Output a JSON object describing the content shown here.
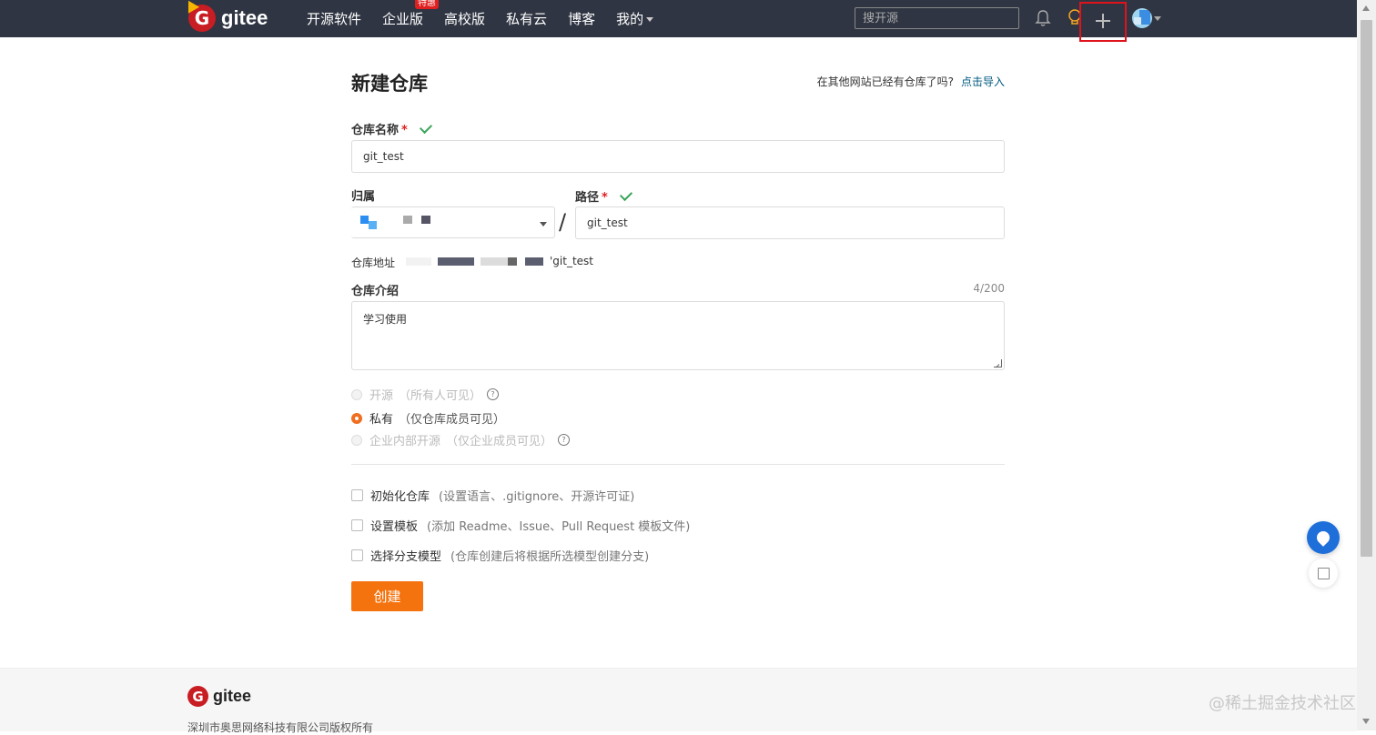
{
  "nav": {
    "brand": "gitee",
    "items": [
      "开源软件",
      "企业版",
      "高校版",
      "私有云",
      "博客",
      "我的"
    ],
    "badge": "特惠",
    "search_placeholder": "搜开源",
    "icons": [
      "bell-icon",
      "bulb-icon",
      "plus-icon",
      "avatar"
    ]
  },
  "form": {
    "title": "新建仓库",
    "import_prompt": "在其他网站已经有仓库了吗?",
    "import_link": "点击导入",
    "repo_name_label": "仓库名称",
    "repo_name_value": "git_test",
    "owner_label": "归属",
    "path_label": "路径",
    "path_value": "git_test",
    "slash": "/",
    "address_label": "仓库地址",
    "address_value": "'git_test",
    "intro_label": "仓库介绍",
    "intro_counter": "4/200",
    "intro_value": "学习使用",
    "visibility": [
      {
        "label": "开源",
        "sub": "（所有人可见）",
        "checked": false,
        "disabled": true,
        "help": true
      },
      {
        "label": "私有",
        "sub": "（仅仓库成员可见）",
        "checked": true,
        "disabled": false,
        "help": false
      },
      {
        "label": "企业内部开源",
        "sub": "（仅企业成员可见）",
        "checked": false,
        "disabled": true,
        "help": true
      }
    ],
    "options": [
      {
        "label": "初始化仓库",
        "sub": "(设置语言、.gitignore、开源许可证)"
      },
      {
        "label": "设置模板",
        "sub": "(添加 Readme、Issue、Pull Request 模板文件)"
      },
      {
        "label": "选择分支模型",
        "sub": "(仓库创建后将根据所选模型创建分支)"
      }
    ],
    "submit_label": "创建"
  },
  "footer": {
    "brand": "gitee",
    "copyright": "深圳市奥思网络科技有限公司版权所有"
  },
  "watermark": "@稀土掘金技术社区",
  "colors": {
    "nav_bg": "#2f3542",
    "accent": "#f5730f",
    "link": "#005980",
    "highlight_box": "#e0131d"
  }
}
